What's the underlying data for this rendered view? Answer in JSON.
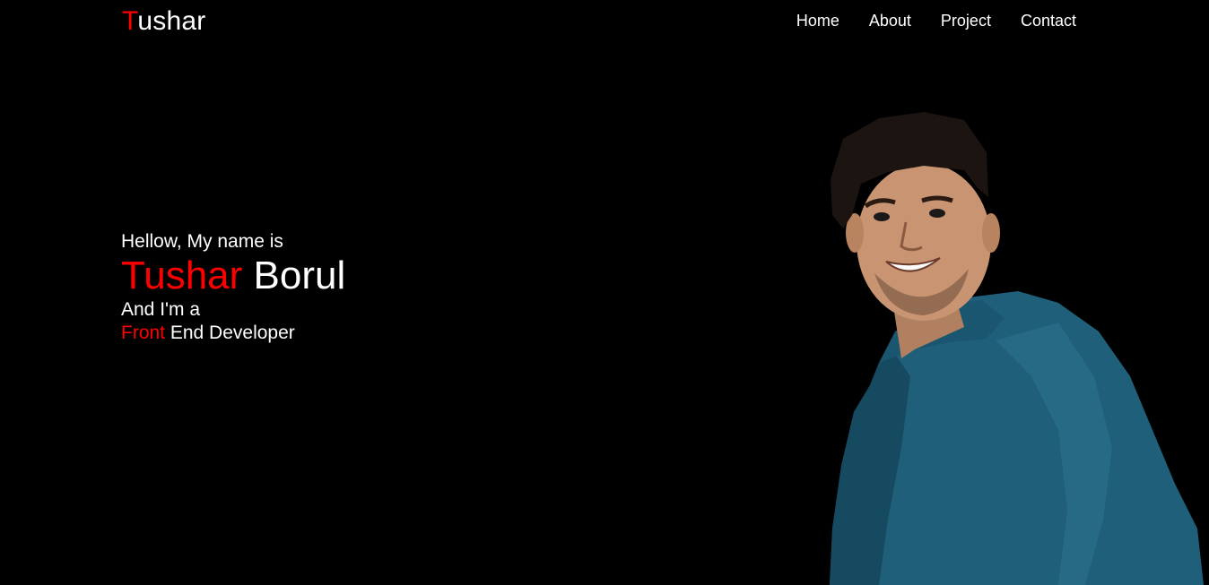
{
  "brand": {
    "logo_first_letter": "T",
    "logo_rest": "ushar"
  },
  "nav": {
    "items": [
      {
        "label": "Home"
      },
      {
        "label": "About"
      },
      {
        "label": "Project"
      },
      {
        "label": "Contact"
      }
    ]
  },
  "hero": {
    "greeting": "Hellow, My name is",
    "first_name": "Tushar",
    "last_name": "Borul",
    "role_intro": "And I'm a",
    "role_highlight": "Front",
    "role_rest": "End Developer"
  },
  "colors": {
    "background": "#000000",
    "accent": "#ff0000",
    "text": "#ffffff",
    "hoodie": "#1f5f7a"
  },
  "icons": {
    "portrait": "person-photo"
  }
}
